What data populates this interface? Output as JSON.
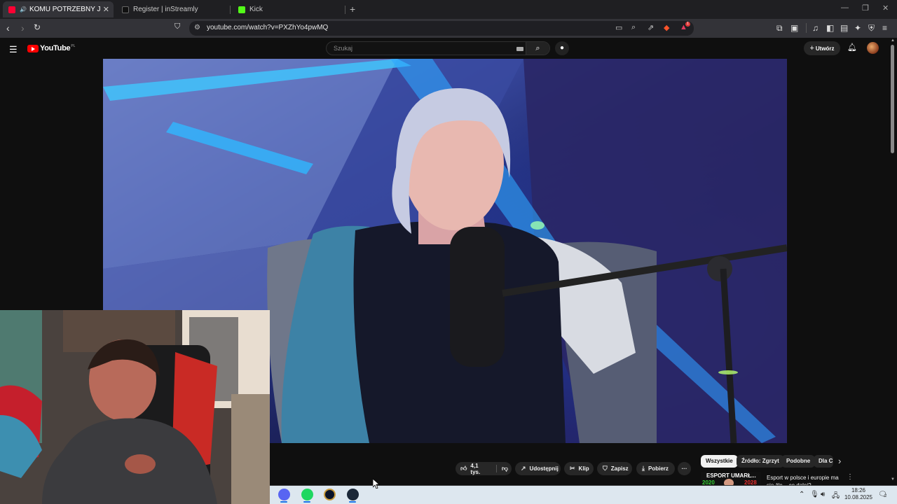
{
  "browser": {
    "tabs": [
      {
        "title": "KOMU POTRZEBNY JEST FEMINIZM?",
        "active": true,
        "favicon_color": "#ff0033"
      },
      {
        "title": "Register | inStreamly",
        "active": false,
        "favicon_color": "#111111"
      },
      {
        "title": "Kick",
        "active": false,
        "favicon_color": "#53fc18"
      }
    ],
    "new_tab_label": "+",
    "window_controls": [
      "—",
      "❐",
      "✕"
    ],
    "tab_close": "✕",
    "url": "youtube.com/watch?v=PXZhYo4pwMQ",
    "brave_badge_count": "1"
  },
  "youtube": {
    "logo_text": "YouTube",
    "country_code": "PL",
    "search_placeholder": "Szukaj",
    "create_label": "Utwórz",
    "actions": {
      "likes": "4,1 tys.",
      "share": "Udostępnij",
      "clip": "Klip",
      "save": "Zapisz",
      "download": "Pobierz",
      "more": "···"
    },
    "chips": [
      "Wszystkie",
      "Źródło: Zgrzyt",
      "Podobne",
      "Dla C"
    ],
    "chips_next": "›",
    "recommendation": {
      "thumb_text": "ESPORT UMARŁ...",
      "thumb_years": [
        "2020",
        "2028"
      ],
      "title": "Esport w polsce i europie ma się źle... co dalej?"
    }
  },
  "taskbar": {
    "apps": [
      "discord",
      "spotify",
      "league-of-legends",
      "steam"
    ],
    "time": "18:26",
    "date": "10.08.2025",
    "notification_count": "2"
  },
  "colors": {
    "yt_red": "#ff0000",
    "dark_bg": "#0f0f0f",
    "chip_bg": "#272727",
    "taskbar_bg": "#dde7ef"
  }
}
